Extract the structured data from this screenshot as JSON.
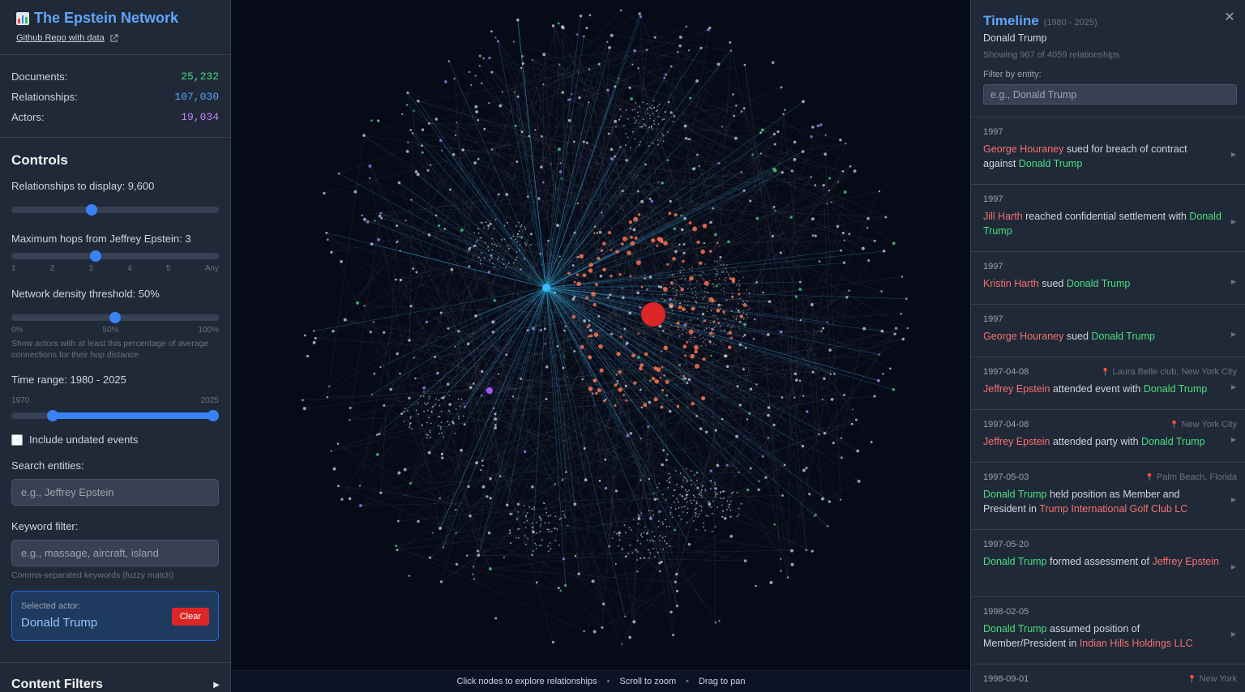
{
  "header": {
    "title": "The Epstein Network",
    "repo_link": "Github Repo with data"
  },
  "stats": [
    {
      "label": "Documents:",
      "value": "25,232",
      "color": "#4ade80"
    },
    {
      "label": "Relationships:",
      "value": "107,030",
      "color": "#60a5fa"
    },
    {
      "label": "Actors:",
      "value": "19,034",
      "color": "#c084fc"
    }
  ],
  "controls": {
    "title": "Controls",
    "relationships_label": "Relationships to display: 9,600",
    "relationships_fraction": 0.38,
    "hops_label": "Maximum hops from Jeffrey Epstein: 3",
    "hops_ticks": [
      "1",
      "2",
      "3",
      "4",
      "5",
      "Any"
    ],
    "hops_value": 3,
    "density_label": "Network density threshold: 50%",
    "density_ticks": [
      "0%",
      "50%",
      "100%"
    ],
    "density_fraction": 0.5,
    "density_hint": "Show actors with at least this percentage of average connections for their hop distance",
    "time_label": "Time range: 1980 - 2025",
    "time_ticks": [
      "1970",
      "2025"
    ],
    "time_range": [
      1980,
      2025
    ],
    "include_undated": "Include undated events",
    "search_label": "Search entities:",
    "search_placeholder": "e.g., Jeffrey Epstein",
    "keyword_label": "Keyword filter:",
    "keyword_placeholder": "e.g., massage, aircraft, island",
    "keyword_hint": "Comma-separated keywords (fuzzy match)",
    "selected_caption": "Selected actor:",
    "selected_name": "Donald Trump",
    "clear_label": "Clear",
    "content_filters": "Content Filters"
  },
  "graph": {
    "help": [
      "Click nodes to explore relationships",
      "Scroll to zoom",
      "Drag to pan"
    ],
    "separator": "•"
  },
  "timeline": {
    "title": "Timeline",
    "range": "(1980 - 2025)",
    "entity": "Donald Trump",
    "count": "Showing 967 of 4059 relationships",
    "filter_label": "Filter by entity:",
    "filter_placeholder": "e.g., Donald Trump",
    "events": [
      {
        "date": "1997",
        "location": "",
        "parts": [
          [
            "r",
            "George Houraney"
          ],
          [
            "t",
            " sued for breach of contract against "
          ],
          [
            "g",
            "Donald Trump"
          ]
        ]
      },
      {
        "date": "1997",
        "location": "",
        "parts": [
          [
            "r",
            "Jill Harth"
          ],
          [
            "t",
            " reached confidential settlement with "
          ],
          [
            "g",
            "Donald Trump"
          ]
        ]
      },
      {
        "date": "1997",
        "location": "",
        "parts": [
          [
            "r",
            "Kristin Harth"
          ],
          [
            "t",
            " sued "
          ],
          [
            "g",
            "Donald Trump"
          ]
        ]
      },
      {
        "date": "1997",
        "location": "",
        "parts": [
          [
            "r",
            "George Houraney"
          ],
          [
            "t",
            " sued "
          ],
          [
            "g",
            "Donald Trump"
          ]
        ]
      },
      {
        "date": "1997-04-08",
        "location": "Laura Belle club, New York City",
        "parts": [
          [
            "r",
            "Jeffrey Epstein"
          ],
          [
            "t",
            " attended event with "
          ],
          [
            "g",
            "Donald Trump"
          ]
        ]
      },
      {
        "date": "1997-04-08",
        "location": "New York City",
        "parts": [
          [
            "r",
            "Jeffrey Epstein"
          ],
          [
            "t",
            " attended party with "
          ],
          [
            "g",
            "Donald Trump"
          ]
        ]
      },
      {
        "date": "1997-05-03",
        "location": "Palm Beach, Florida",
        "parts": [
          [
            "g",
            "Donald Trump"
          ],
          [
            "t",
            " held position as Member and President in "
          ],
          [
            "r",
            "Trump International Golf Club LC"
          ]
        ]
      },
      {
        "date": "1997-05-20",
        "location": "",
        "parts": [
          [
            "g",
            "Donald Trump"
          ],
          [
            "t",
            " formed assessment of "
          ],
          [
            "r",
            "Jeffrey Epstein"
          ]
        ]
      },
      {
        "date": "1998-02-05",
        "location": "",
        "parts": [
          [
            "g",
            "Donald Trump"
          ],
          [
            "t",
            " assumed position of Member/President in "
          ],
          [
            "r",
            "Indian Hills Holdings LLC"
          ]
        ]
      },
      {
        "date": "1998-09-01",
        "location": "New York",
        "parts": []
      }
    ]
  }
}
